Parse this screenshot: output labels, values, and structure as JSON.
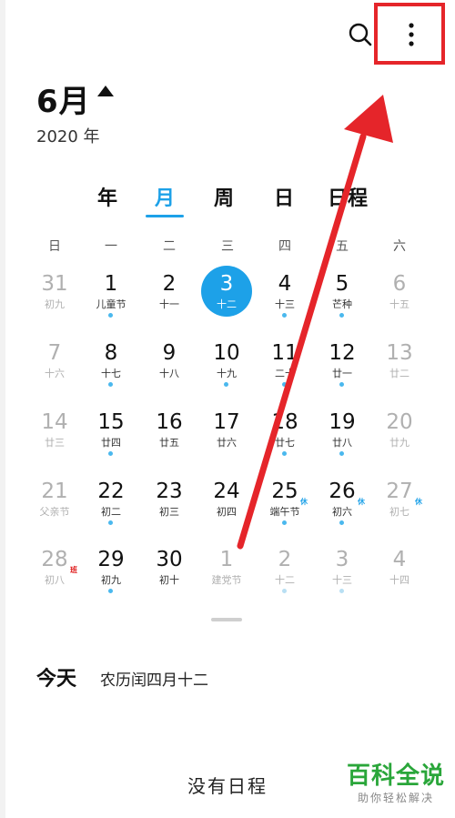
{
  "header": {
    "search_icon": "search-icon",
    "more_icon": "more-vertical-icon",
    "month": "6月",
    "year": "2020 年"
  },
  "view_tabs": [
    {
      "label": "年",
      "active": false
    },
    {
      "label": "月",
      "active": true
    },
    {
      "label": "周",
      "active": false
    },
    {
      "label": "日",
      "active": false
    },
    {
      "label": "日程",
      "active": false
    }
  ],
  "weekdays": [
    "日",
    "一",
    "二",
    "三",
    "四",
    "五",
    "六"
  ],
  "weeks": [
    [
      {
        "d": "31",
        "l": "初九",
        "other": true
      },
      {
        "d": "1",
        "l": "儿童节",
        "dot": true
      },
      {
        "d": "2",
        "l": "十一"
      },
      {
        "d": "3",
        "l": "十二",
        "today": true,
        "dot": true
      },
      {
        "d": "4",
        "l": "十三",
        "dot": true
      },
      {
        "d": "5",
        "l": "芒种",
        "dot": true
      },
      {
        "d": "6",
        "l": "十五",
        "other": true
      }
    ],
    [
      {
        "d": "7",
        "l": "十六",
        "other": true
      },
      {
        "d": "8",
        "l": "十七",
        "dot": true
      },
      {
        "d": "9",
        "l": "十八"
      },
      {
        "d": "10",
        "l": "十九",
        "dot": true
      },
      {
        "d": "11",
        "l": "二十",
        "dot": true
      },
      {
        "d": "12",
        "l": "廿一",
        "dot": true
      },
      {
        "d": "13",
        "l": "廿二",
        "other": true
      }
    ],
    [
      {
        "d": "14",
        "l": "廿三",
        "other": true
      },
      {
        "d": "15",
        "l": "廿四",
        "dot": true
      },
      {
        "d": "16",
        "l": "廿五"
      },
      {
        "d": "17",
        "l": "廿六"
      },
      {
        "d": "18",
        "l": "廿七",
        "dot": true
      },
      {
        "d": "19",
        "l": "廿八",
        "dot": true
      },
      {
        "d": "20",
        "l": "廿九",
        "other": true
      }
    ],
    [
      {
        "d": "21",
        "l": "父亲节",
        "other": true
      },
      {
        "d": "22",
        "l": "初二",
        "dot": true
      },
      {
        "d": "23",
        "l": "初三"
      },
      {
        "d": "24",
        "l": "初四"
      },
      {
        "d": "25",
        "l": "端午节",
        "badge": "休",
        "dot": true
      },
      {
        "d": "26",
        "l": "初六",
        "badge": "休",
        "dot": true
      },
      {
        "d": "27",
        "l": "初七",
        "badge": "休",
        "other": true
      }
    ],
    [
      {
        "d": "28",
        "l": "初八",
        "badge": "班",
        "other": true
      },
      {
        "d": "29",
        "l": "初九",
        "dot": true
      },
      {
        "d": "30",
        "l": "初十"
      },
      {
        "d": "1",
        "l": "建党节",
        "next": true
      },
      {
        "d": "2",
        "l": "十二",
        "next": true,
        "dot": true
      },
      {
        "d": "3",
        "l": "十三",
        "next": true,
        "dot": true
      },
      {
        "d": "4",
        "l": "十四",
        "next": true
      }
    ]
  ],
  "today_panel": {
    "label": "今天",
    "lunar": "农历闰四月十二",
    "empty_text": "没有日程"
  },
  "annotation": {
    "box_color": "#e5252a",
    "arrow_color": "#e5252a"
  },
  "watermark": {
    "main": "百科全说",
    "sub": "助你轻松解决"
  },
  "colors": {
    "accent": "#1da1e8",
    "dot": "#4ab8ee",
    "muted": "#b0b0b0",
    "watermark_green": "#2aa63a"
  }
}
